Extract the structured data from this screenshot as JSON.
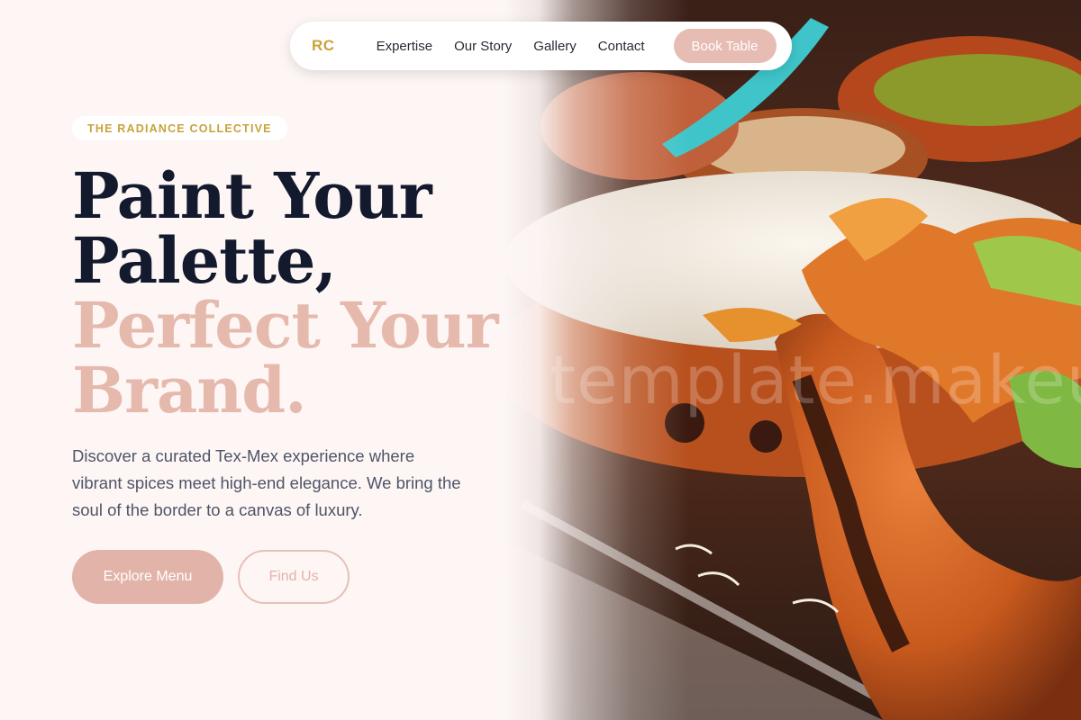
{
  "nav": {
    "brand": "RC",
    "links": [
      "Expertise",
      "Our Story",
      "Gallery",
      "Contact"
    ],
    "cta": "Book Table"
  },
  "hero": {
    "eyebrow": "THE RADIANCE COLLECTIVE",
    "headline_line1": "Paint Your",
    "headline_line2": "Palette,",
    "headline_line3": "Perfect Your",
    "headline_line4": "Brand.",
    "description": "Discover a curated Tex-Mex experience where vibrant spices meet high-end elegance. We bring the soul of the border to a canvas of luxury.",
    "primary_button": "Explore Menu",
    "secondary_button": "Find Us",
    "watermark": "template.makeup"
  },
  "colors": {
    "accent_gold": "#c9a23a",
    "accent_blush": "#e2b4a9",
    "headline_dark": "#141a2e",
    "background": "#fdf6f5"
  }
}
